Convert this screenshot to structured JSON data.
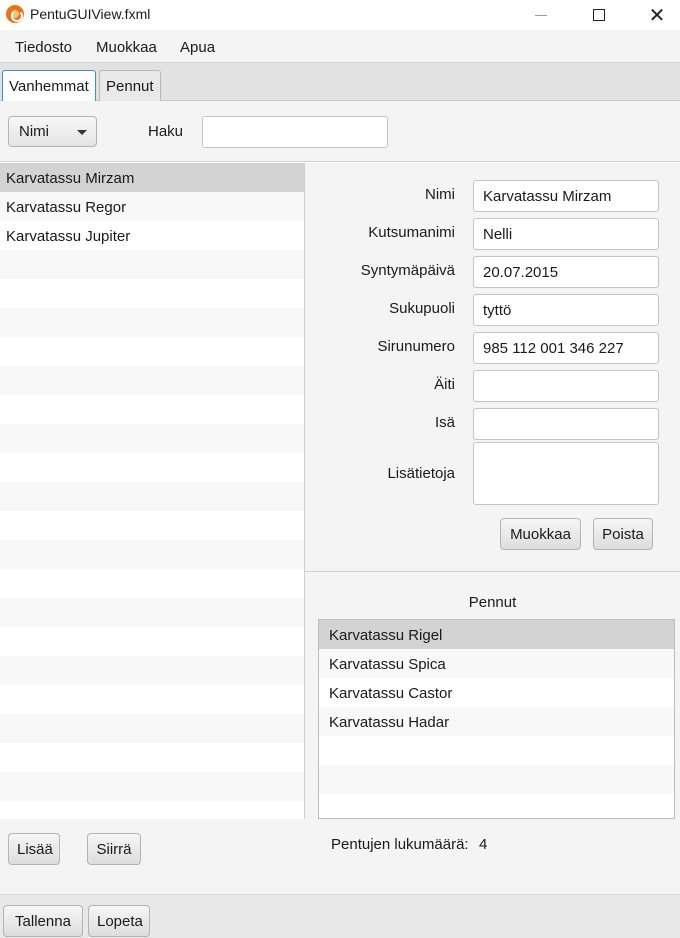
{
  "window": {
    "title": "PentuGUIView.fxml"
  },
  "menu": {
    "items": [
      "Tiedosto",
      "Muokkaa",
      "Apua"
    ]
  },
  "tabs": [
    "Vanhemmat",
    "Pennut"
  ],
  "search": {
    "field_value": "Nimi",
    "label": "Haku",
    "value": ""
  },
  "parents": [
    "Karvatassu Mirzam",
    "Karvatassu Regor",
    "Karvatassu Jupiter"
  ],
  "detail": {
    "labels": [
      "Nimi",
      "Kutsumanimi",
      "Syntymäpäivä",
      "Sukupuoli",
      "Sirunumero",
      "Äiti",
      "Isä",
      "Lisätietoja"
    ],
    "values": [
      "Karvatassu Mirzam",
      "Nelli",
      "20.07.2015",
      "tyttö",
      "985 112 001 346 227",
      "",
      "",
      ""
    ],
    "edit_label": "Muokkaa",
    "delete_label": "Poista"
  },
  "puppies": {
    "title": "Pennut",
    "items": [
      "Karvatassu Rigel",
      "Karvatassu Spica",
      "Karvatassu Castor",
      "Karvatassu Hadar"
    ],
    "count_label": "Pentujen lukumäärä:",
    "count": "4"
  },
  "left_buttons": {
    "add": "Lisää",
    "move": "Siirrä"
  },
  "bottom_buttons": {
    "save": "Tallenna",
    "quit": "Lopeta"
  }
}
